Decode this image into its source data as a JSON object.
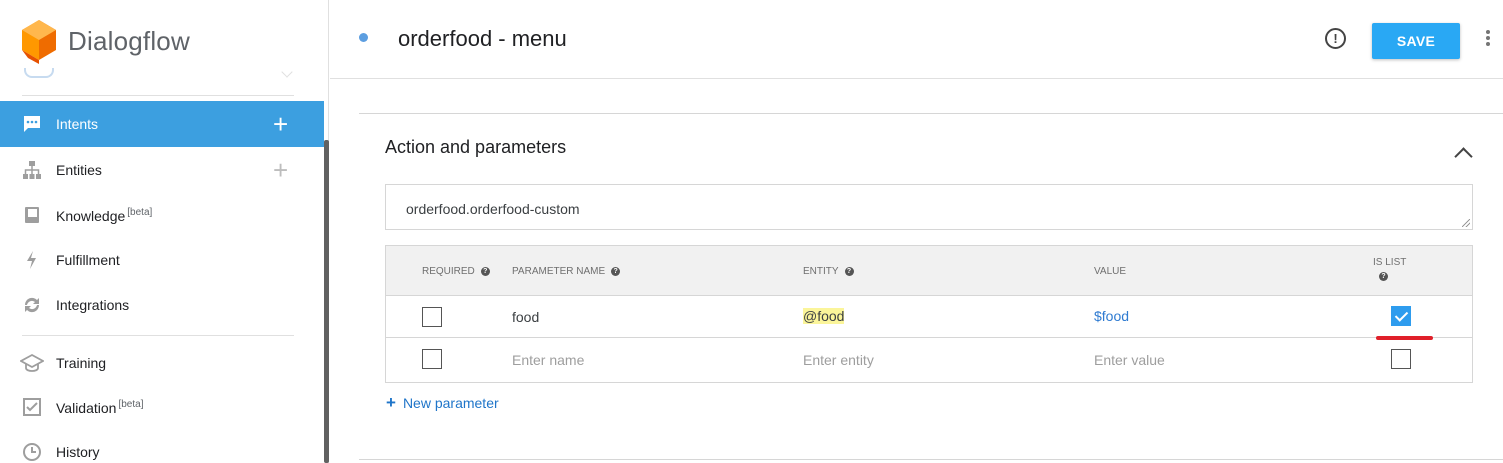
{
  "app": {
    "name": "Dialogflow"
  },
  "sidebar": {
    "items": [
      {
        "id": "intents",
        "label": "Intents",
        "icon": "chat-bubble-icon",
        "active": true,
        "has_add": true
      },
      {
        "id": "entities",
        "label": "Entities",
        "icon": "hierarchy-icon",
        "active": false,
        "has_add": true
      },
      {
        "id": "knowledge",
        "label": "Knowledge",
        "badge": "[beta]",
        "icon": "book-icon",
        "active": false
      },
      {
        "id": "fulfillment",
        "label": "Fulfillment",
        "icon": "lightning-icon",
        "active": false
      },
      {
        "id": "integrations",
        "label": "Integrations",
        "icon": "sync-icon",
        "active": false
      },
      {
        "id": "training",
        "label": "Training",
        "icon": "graduation-cap-icon",
        "active": false
      },
      {
        "id": "validation",
        "label": "Validation",
        "badge": "[beta]",
        "icon": "check-box-icon",
        "active": false
      },
      {
        "id": "history",
        "label": "History",
        "icon": "clock-icon",
        "active": false
      }
    ],
    "add_symbol": "+"
  },
  "header": {
    "title": "orderfood - menu",
    "info_symbol": "!",
    "save_label": "SAVE"
  },
  "section": {
    "title": "Action and parameters",
    "action_value": "orderfood.orderfood-custom"
  },
  "params_table": {
    "columns": {
      "required": "REQUIRED",
      "name": "PARAMETER NAME",
      "entity": "ENTITY",
      "value": "VALUE",
      "is_list": "IS LIST",
      "help": "?"
    },
    "rows": [
      {
        "required": false,
        "name": "food",
        "entity": "@food",
        "value": "$food",
        "is_list": true
      }
    ],
    "new_row": {
      "required": false,
      "name_placeholder": "Enter name",
      "entity_placeholder": "Enter entity",
      "value_placeholder": "Enter value",
      "is_list": false
    },
    "new_parameter_label": "New parameter",
    "new_parameter_plus": "+"
  },
  "colors": {
    "accent": "#3c9fe0",
    "save": "#29a8f4",
    "link": "#1f75c9",
    "highlight": "#fbf59a",
    "annotation": "#e0202a"
  }
}
